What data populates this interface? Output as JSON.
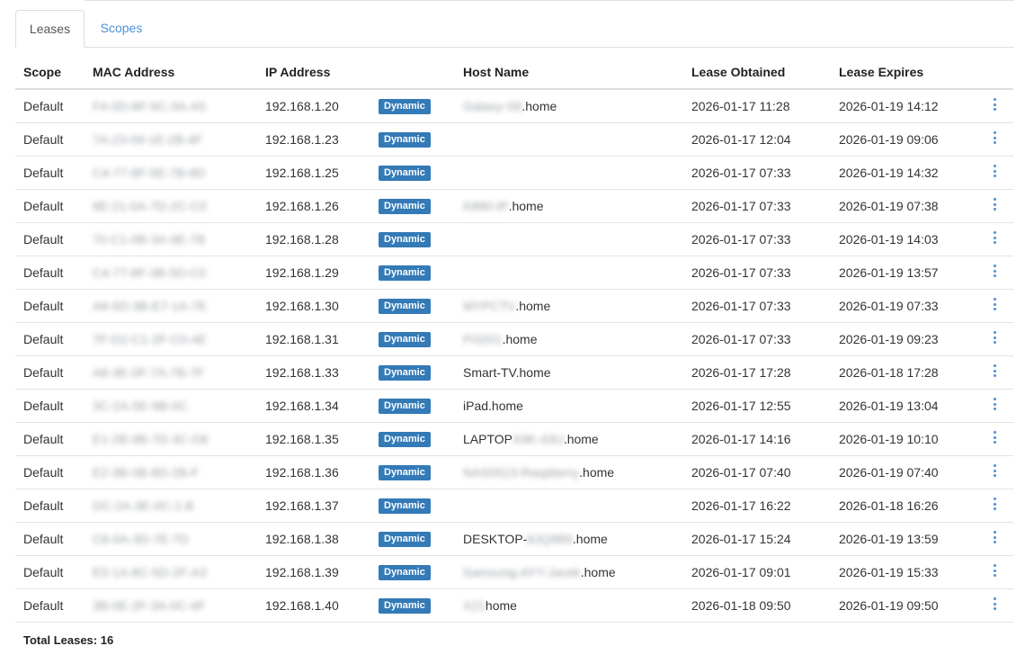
{
  "tabs": {
    "leases_label": "Leases",
    "scopes_label": "Scopes",
    "active": "Leases"
  },
  "table": {
    "headers": {
      "scope": "Scope",
      "mac": "MAC Address",
      "ip": "IP Address",
      "type": "",
      "host": "Host Name",
      "obtained": "Lease Obtained",
      "expires": "Lease Expires"
    },
    "rows": [
      {
        "scope": "Default",
        "mac_visible": "",
        "mac_blur": "F4-0D-8F-9C-3A-A5",
        "ip": "192.168.1.20",
        "type": "Dynamic",
        "host_blur": "Galaxy-S6",
        "host_visible": ".home",
        "obtained": "2026-01-17 11:28",
        "expires": "2026-01-19 14:12"
      },
      {
        "scope": "Default",
        "mac_visible": "",
        "mac_blur": "7A-23-09-1E-2B-4F",
        "ip": "192.168.1.23",
        "type": "Dynamic",
        "host_blur": "",
        "host_visible": "",
        "obtained": "2026-01-17 12:04",
        "expires": "2026-01-19 09:06"
      },
      {
        "scope": "Default",
        "mac_visible": "",
        "mac_blur": "C4-77-8F-5E-7B-8D",
        "ip": "192.168.1.25",
        "type": "Dynamic",
        "host_blur": "",
        "host_visible": "",
        "obtained": "2026-01-17 07:33",
        "expires": "2026-01-19 14:32"
      },
      {
        "scope": "Default",
        "mac_visible": "",
        "mac_blur": "8E-21-0A-7D-2C-C0",
        "ip": "192.168.1.26",
        "type": "Dynamic",
        "host_blur": "K880-IP",
        "host_visible": ".home",
        "obtained": "2026-01-17 07:33",
        "expires": "2026-01-19 07:38"
      },
      {
        "scope": "Default",
        "mac_visible": "",
        "mac_blur": "70-C1-0B-3A-9E-7B",
        "ip": "192.168.1.28",
        "type": "Dynamic",
        "host_blur": "",
        "host_visible": "",
        "obtained": "2026-01-17 07:33",
        "expires": "2026-01-19 14:03"
      },
      {
        "scope": "Default",
        "mac_visible": "",
        "mac_blur": "C4-77-8F-3B-5D-C0",
        "ip": "192.168.1.29",
        "type": "Dynamic",
        "host_blur": "",
        "host_visible": "",
        "obtained": "2026-01-17 07:33",
        "expires": "2026-01-19 13:57"
      },
      {
        "scope": "Default",
        "mac_visible": "",
        "mac_blur": "A8-5D-3B-E7-1A-7E",
        "ip": "192.168.1.30",
        "type": "Dynamic",
        "host_blur": "MYPCTV",
        "host_visible": ".home",
        "obtained": "2026-01-17 07:33",
        "expires": "2026-01-19 07:33"
      },
      {
        "scope": "Default",
        "mac_visible": "",
        "mac_blur": "7F-D2-C1-2F-C0-4E",
        "ip": "192.168.1.31",
        "type": "Dynamic",
        "host_blur": "Pi3201",
        "host_visible": ".home",
        "obtained": "2026-01-17 07:33",
        "expires": "2026-01-19 09:23"
      },
      {
        "scope": "Default",
        "mac_visible": "",
        "mac_blur": "A6-3E-0F-7A-7B-7F",
        "ip": "192.168.1.33",
        "type": "Dynamic",
        "host_blur": "",
        "host_visible": "Smart-TV.home",
        "obtained": "2026-01-17 17:28",
        "expires": "2026-01-18 17:28"
      },
      {
        "scope": "Default",
        "mac_visible": "",
        "mac_blur": "3C-2A-5E-9B-0C",
        "ip": "192.168.1.34",
        "type": "Dynamic",
        "host_blur": "",
        "host_visible": "iPad.home",
        "obtained": "2026-01-17 12:55",
        "expires": "2026-01-19 13:04"
      },
      {
        "scope": "Default",
        "mac_visible": "",
        "mac_blur": "E1-2B-9B-7D-3C-D8",
        "ip": "192.168.1.35",
        "type": "Dynamic",
        "host_blur": "X9K-43U",
        "host_visible_pre": "LAPTOP",
        "host_visible": ".home",
        "obtained": "2026-01-17 14:16",
        "expires": "2026-01-19 10:10"
      },
      {
        "scope": "Default",
        "mac_visible": "",
        "mac_blur": "E2-3B-0B-8D-2B-F",
        "ip": "192.168.1.36",
        "type": "Dynamic",
        "host_blur": "NAS0513-Raspberry",
        "host_visible": ".home",
        "obtained": "2026-01-17 07:40",
        "expires": "2026-01-19 07:40"
      },
      {
        "scope": "Default",
        "mac_visible": "",
        "mac_blur": "DC-2A-3E-0C-1-B",
        "ip": "192.168.1.37",
        "type": "Dynamic",
        "host_blur": "",
        "host_visible": "",
        "obtained": "2026-01-17 16:22",
        "expires": "2026-01-18 16:26"
      },
      {
        "scope": "Default",
        "mac_visible": "",
        "mac_blur": "C8-0A-3D-7E-7D",
        "ip": "192.168.1.38",
        "type": "Dynamic",
        "host_blur": "8JQ9B9",
        "host_visible_pre": "DESKTOP-",
        "host_visible": ".home",
        "obtained": "2026-01-17 15:24",
        "expires": "2026-01-19 13:59"
      },
      {
        "scope": "Default",
        "mac_visible": "",
        "mac_blur": "E0-1A-8C-5D-2F-A3",
        "ip": "192.168.1.39",
        "type": "Dynamic",
        "host_blur": "Samsung-AYY-Jacek",
        "host_visible": ".home",
        "obtained": "2026-01-17 09:01",
        "expires": "2026-01-19 15:33"
      },
      {
        "scope": "Default",
        "mac_visible": "",
        "mac_blur": "3B-0E-2F-3A-0C-4F",
        "ip": "192.168.1.40",
        "type": "Dynamic",
        "host_blur": "X21",
        "host_visible": "home",
        "obtained": "2026-01-18 09:50",
        "expires": "2026-01-19 09:50"
      }
    ]
  },
  "footer": {
    "total_label": "Total Leases: 16"
  },
  "icons": {
    "row_menu": "kebab-vertical-icon"
  },
  "colors": {
    "badge_bg": "#337ab7",
    "link": "#4a90d9",
    "border": "#dddddd"
  }
}
